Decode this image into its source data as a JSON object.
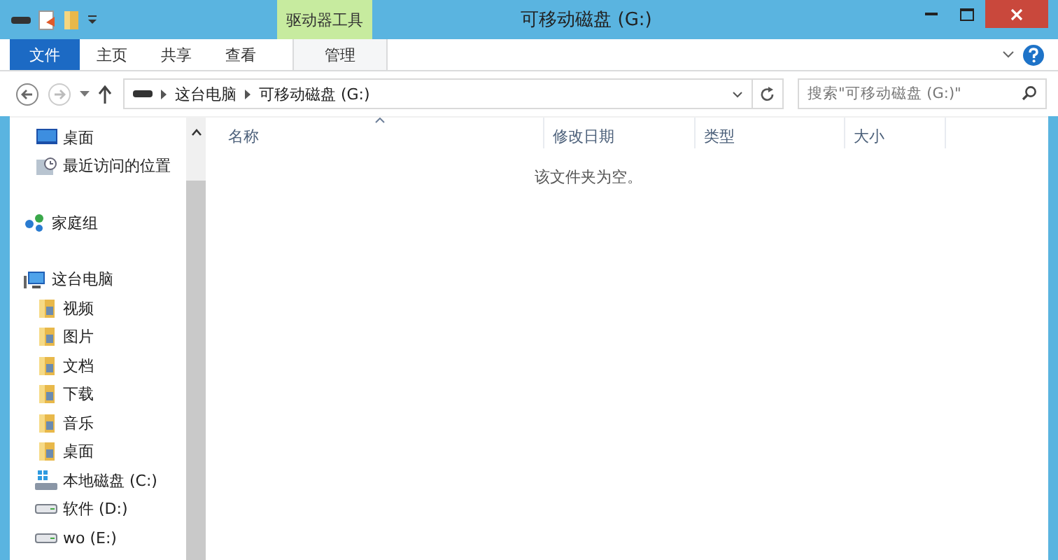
{
  "window": {
    "title": "可移动磁盘 (G:)",
    "context_group": "驱动器工具"
  },
  "tabs": [
    {
      "label": "文件",
      "kind": "file"
    },
    {
      "label": "主页",
      "kind": "normal"
    },
    {
      "label": "共享",
      "kind": "normal"
    },
    {
      "label": "查看",
      "kind": "normal"
    },
    {
      "label": "管理",
      "kind": "contextual"
    }
  ],
  "address": {
    "crumbs": [
      "这台电脑",
      "可移动磁盘 (G:)"
    ]
  },
  "search": {
    "placeholder": "搜索\"可移动磁盘 (G:)\""
  },
  "nav": [
    {
      "items": [
        {
          "label": "桌面",
          "kind": "desktop"
        },
        {
          "label": "最近访问的位置",
          "kind": "recent"
        }
      ]
    },
    {
      "label": "家庭组",
      "kind": "homegroup"
    },
    {
      "label": "这台电脑",
      "kind": "computer",
      "children": [
        {
          "label": "视频",
          "kind": "folder"
        },
        {
          "label": "图片",
          "kind": "folder"
        },
        {
          "label": "文档",
          "kind": "folder"
        },
        {
          "label": "下载",
          "kind": "folder"
        },
        {
          "label": "音乐",
          "kind": "folder"
        },
        {
          "label": "桌面",
          "kind": "folder"
        },
        {
          "label": "本地磁盘 (C:)",
          "kind": "system"
        },
        {
          "label": "软件 (D:)",
          "kind": "drive"
        },
        {
          "label": "wo (E:)",
          "kind": "drive"
        }
      ]
    }
  ],
  "columns": [
    {
      "label": "名称",
      "sorted": true
    },
    {
      "label": "修改日期",
      "sorted": false
    },
    {
      "label": "类型",
      "sorted": false
    },
    {
      "label": "大小",
      "sorted": false
    }
  ],
  "empty_message": "该文件夹为空。"
}
